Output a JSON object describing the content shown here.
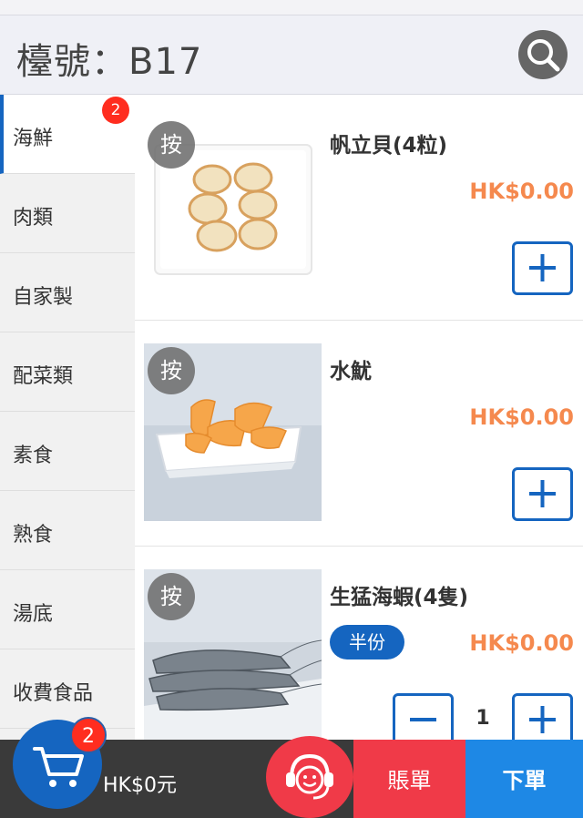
{
  "header": {
    "title": "檯號：B17",
    "search_icon": "search-icon"
  },
  "sidebar": {
    "items": [
      {
        "label": "海鮮",
        "badge": "2",
        "active": true
      },
      {
        "label": "肉類"
      },
      {
        "label": "自家製"
      },
      {
        "label": "配菜類"
      },
      {
        "label": "素食"
      },
      {
        "label": "熟食"
      },
      {
        "label": "湯底"
      },
      {
        "label": "收費食品"
      }
    ]
  },
  "products": [
    {
      "name": "帆立貝(4粒)",
      "price": "HK$0.00",
      "press_label": "按",
      "image": "scallops-photo"
    },
    {
      "name": "水魷",
      "price": "HK$0.00",
      "press_label": "按",
      "image": "squid-photo"
    },
    {
      "name": "生猛海蝦(4隻)",
      "price": "HK$0.00",
      "press_label": "按",
      "half_label": "半份",
      "quantity": "1",
      "image": "prawns-photo"
    }
  ],
  "footer": {
    "cart_count": "2",
    "total": "HK$0元",
    "bill_label": "賬單",
    "order_label": "下單"
  },
  "colors": {
    "brand_blue": "#1565c0",
    "price_orange": "#f5894e",
    "badge_red": "#ff2d1f",
    "bill_red": "#f03a48",
    "order_blue": "#1e88e5"
  }
}
